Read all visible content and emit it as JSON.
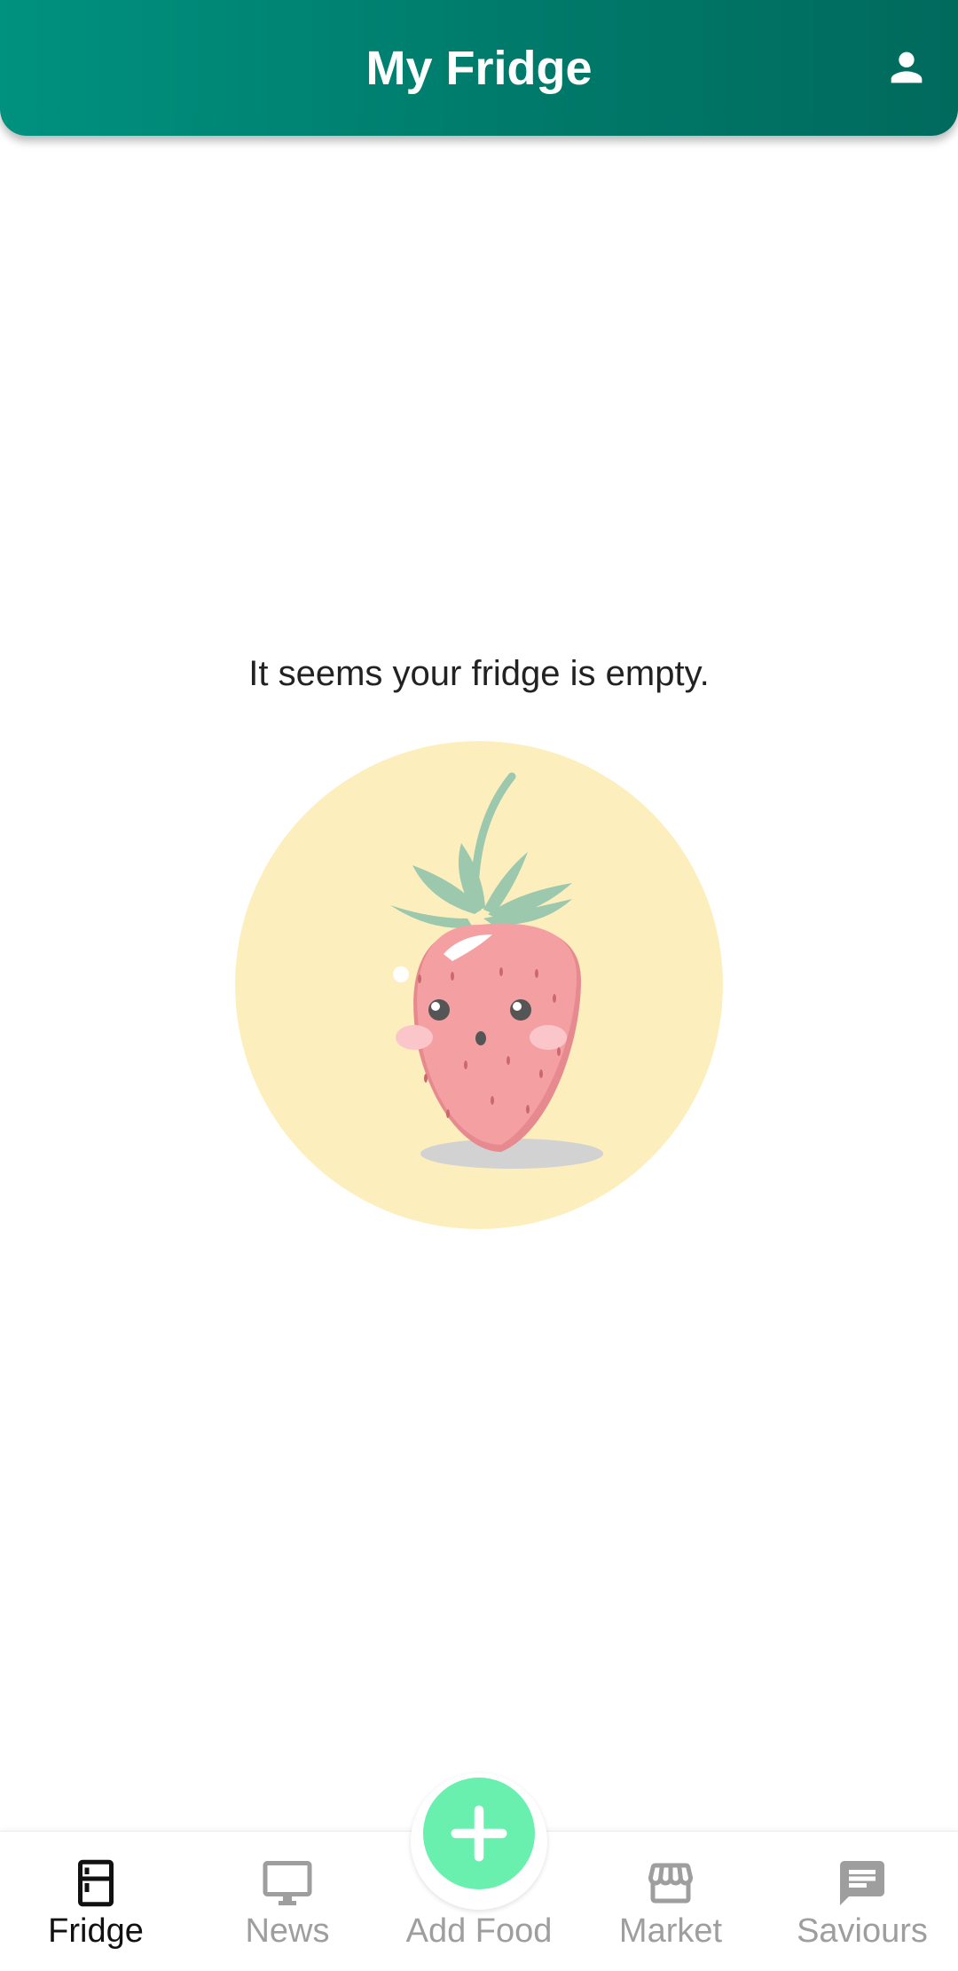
{
  "app_bar": {
    "title": "My Fridge",
    "profile_icon": "person-icon",
    "background": "#00897b"
  },
  "empty_state": {
    "message": "It seems your fridge is empty.",
    "illustration": "strawberry-illustration",
    "circle_color": "#fdefbd"
  },
  "add_food": {
    "label": "Add Food",
    "icon": "plus-icon",
    "color": "#69f0ae"
  },
  "bottom_nav": {
    "active": "Fridge",
    "items": [
      {
        "label": "Fridge",
        "icon": "fridge-icon"
      },
      {
        "label": "News",
        "icon": "monitor-icon"
      },
      {
        "label": "Add Food",
        "icon": "plus-icon"
      },
      {
        "label": "Market",
        "icon": "storefront-icon"
      },
      {
        "label": "Saviours",
        "icon": "chat-icon"
      }
    ]
  }
}
